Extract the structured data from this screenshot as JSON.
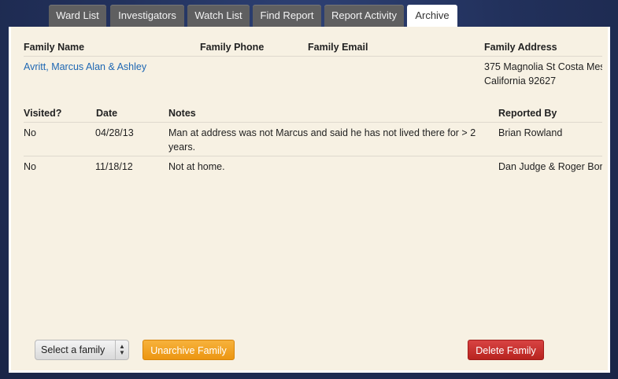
{
  "tabs": [
    {
      "label": "Ward List"
    },
    {
      "label": "Investigators"
    },
    {
      "label": "Watch List"
    },
    {
      "label": "Find Report"
    },
    {
      "label": "Report Activity"
    },
    {
      "label": "Archive"
    }
  ],
  "family_table": {
    "headers": {
      "name": "Family Name",
      "phone": "Family Phone",
      "email": "Family Email",
      "address": "Family Address"
    },
    "row": {
      "name": "Avritt, Marcus Alan & Ashley",
      "phone": "",
      "email": "",
      "address_line1": "375 Magnolia St Costa Mes",
      "address_line2": "California 92627"
    }
  },
  "visits_table": {
    "headers": {
      "visited": "Visited?",
      "date": "Date",
      "notes": "Notes",
      "reported_by": "Reported By"
    },
    "rows": [
      {
        "visited": "No",
        "date": "04/28/13",
        "notes_line1": "Man at address was not Marcus and said he has not lived there for > 2",
        "notes_line2": "years.",
        "reported_by": "Brian Rowland"
      },
      {
        "visited": "No",
        "date": "11/18/12",
        "notes_line1": "Not at home.",
        "notes_line2": "",
        "reported_by": "Dan Judge & Roger Borg"
      }
    ]
  },
  "footer": {
    "select_value": "Select a family",
    "unarchive_label": "Unarchive Family",
    "delete_label": "Delete Family"
  },
  "colors": {
    "accent_orange": "#ec9611",
    "danger_red": "#c02e2a",
    "link_blue": "#1e67b3",
    "panel_bg": "#f7f1e3"
  }
}
